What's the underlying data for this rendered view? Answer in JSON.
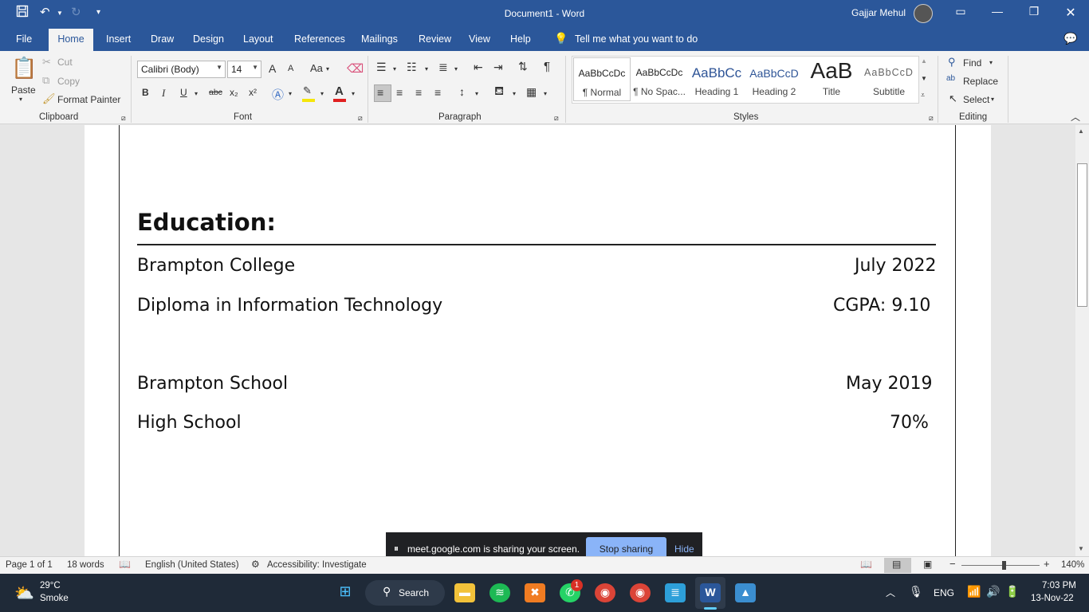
{
  "titlebar": {
    "doc_title": "Document1 - Word",
    "user": "Gajjar Mehul"
  },
  "tabs": [
    "File",
    "Home",
    "Insert",
    "Draw",
    "Design",
    "Layout",
    "References",
    "Mailings",
    "Review",
    "View",
    "Help"
  ],
  "tell_me": "Tell me what you want to do",
  "clipboard": {
    "paste": "Paste",
    "cut": "Cut",
    "copy": "Copy",
    "format_painter": "Format Painter",
    "label": "Clipboard"
  },
  "font": {
    "family": "Calibri (Body)",
    "size": "14",
    "label": "Font",
    "bold": "B",
    "italic": "I",
    "underline": "U",
    "strike": "abc",
    "subscript": "x₂",
    "superscript": "x²",
    "grow": "A",
    "shrink": "A",
    "change_case": "Aa"
  },
  "paragraph": {
    "label": "Paragraph"
  },
  "styles": {
    "label": "Styles",
    "items": [
      {
        "sample": "AaBbCcDc",
        "name": "¶ Normal"
      },
      {
        "sample": "AaBbCcDc",
        "name": "¶ No Spac..."
      },
      {
        "sample": "AaBbCc",
        "name": "Heading 1"
      },
      {
        "sample": "AaBbCcD",
        "name": "Heading 2"
      },
      {
        "sample": "AaB",
        "name": "Title"
      },
      {
        "sample": "AaBbCcD",
        "name": "Subtitle"
      }
    ]
  },
  "editing": {
    "label": "Editing",
    "find": "Find",
    "replace": "Replace",
    "select": "Select"
  },
  "document": {
    "heading": "Education:",
    "entries": [
      {
        "left": "Brampton College",
        "right": "July 2022"
      },
      {
        "left": "Diploma in Information Technology",
        "right": "CGPA: 9.10"
      },
      {
        "left": "Brampton School",
        "right": "May 2019"
      },
      {
        "left": "High School",
        "right": "70%"
      }
    ]
  },
  "sharebar": {
    "text": "meet.google.com is sharing your screen.",
    "stop": "Stop sharing",
    "hide": "Hide"
  },
  "statusbar": {
    "page": "Page 1 of 1",
    "words": "18 words",
    "language": "English (United States)",
    "accessibility": "Accessibility: Investigate",
    "zoom": "140%"
  },
  "taskbar": {
    "temp": "29°C",
    "weather": "Smoke",
    "search": "Search",
    "lang": "ENG",
    "time": "7:03 PM",
    "date": "13-Nov-22",
    "whatsapp_badge": "1"
  }
}
